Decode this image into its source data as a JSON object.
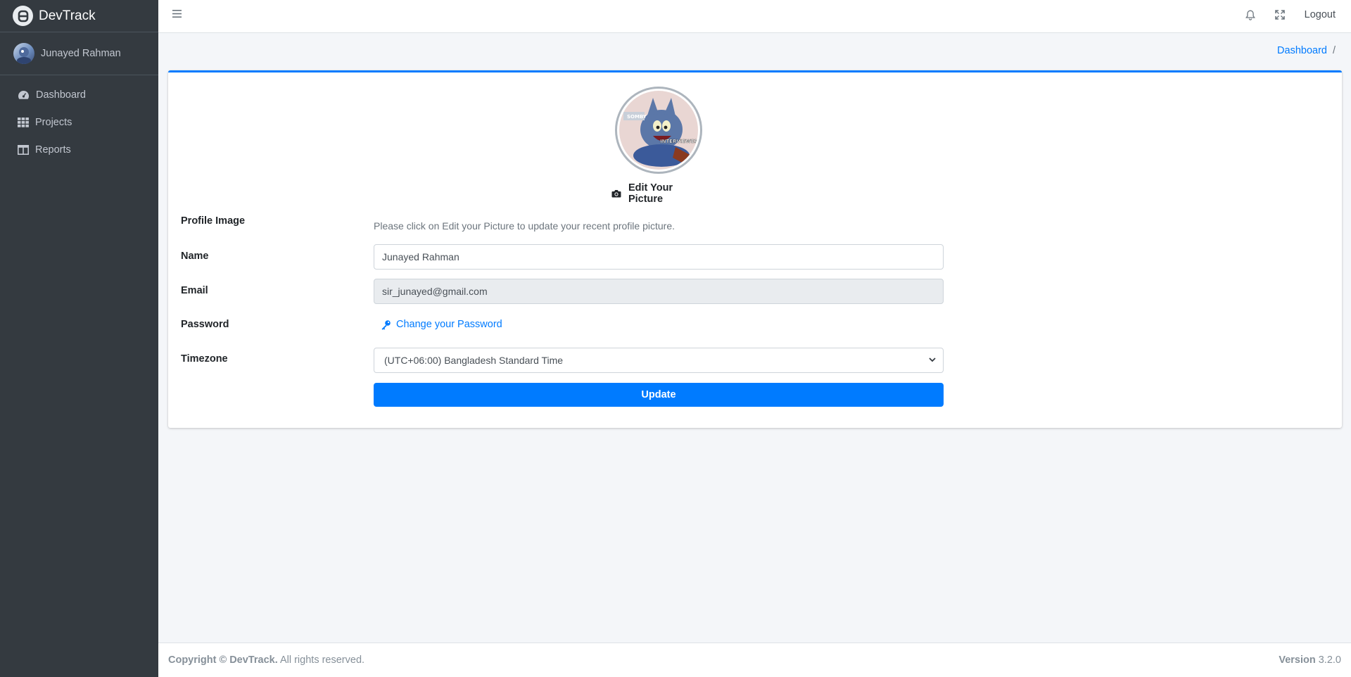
{
  "app": {
    "brand": "DevTrack"
  },
  "sidebar": {
    "user_name": "Junayed Rahman",
    "items": [
      {
        "label": "Dashboard",
        "icon": "tachometer-icon"
      },
      {
        "label": "Projects",
        "icon": "grid-icon"
      },
      {
        "label": "Reports",
        "icon": "columns-icon"
      }
    ]
  },
  "topbar": {
    "logout_label": "Logout"
  },
  "breadcrumb": {
    "item": "Dashboard",
    "separator": "/"
  },
  "profile": {
    "edit_picture_label": "Edit Your Picture",
    "picture_caption_top": "SOMBY",
    "picture_caption_bottom": "INTERVIEWER"
  },
  "form": {
    "profile_image_label": "Profile Image",
    "profile_image_help": "Please click on Edit your Picture to update your recent profile picture.",
    "name_label": "Name",
    "name_value": "Junayed Rahman",
    "email_label": "Email",
    "email_value": "sir_junayed@gmail.com",
    "password_label": "Password",
    "change_password_label": "Change your Password",
    "timezone_label": "Timezone",
    "timezone_value": "(UTC+06:00) Bangladesh Standard Time",
    "update_label": "Update"
  },
  "footer": {
    "copyright_bold": "Copyright © DevTrack.",
    "copyright_rest": " All rights reserved.",
    "version_label": "Version",
    "version_value": " 3.2.0"
  },
  "colors": {
    "primary": "#007bff",
    "sidebar": "#343a40"
  }
}
